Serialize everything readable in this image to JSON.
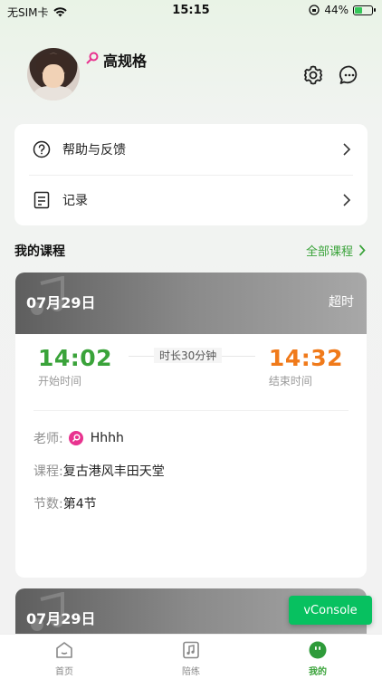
{
  "status_bar": {
    "carrier": "无SIM卡",
    "time": "15:15",
    "battery": "44%",
    "battery_level": 0.44
  },
  "profile": {
    "name": "高规格",
    "gender_icon": "female-symbol-icon"
  },
  "menu": [
    {
      "label": "帮助与反馈",
      "icon": "help-circle-icon"
    },
    {
      "label": "记录",
      "icon": "document-icon"
    }
  ],
  "courses_section": {
    "title": "我的课程",
    "link": "全部课程"
  },
  "courses": [
    {
      "date": "07月29日",
      "status": "超时",
      "start_time": "14:02",
      "start_label": "开始时间",
      "duration": "时长30分钟",
      "end_time": "14:32",
      "end_label": "结束时间",
      "teacher_key": "老师:",
      "teacher_value": "Hhhh",
      "course_key": "课程:",
      "course_value": "复古港风丰田天堂",
      "lesson_key": "节数:",
      "lesson_value": "第4节"
    },
    {
      "date": "07月29日"
    }
  ],
  "vconsole": "vConsole",
  "tabs": [
    {
      "label": "首页",
      "icon": "home-icon",
      "active": false
    },
    {
      "label": "陪练",
      "icon": "music-note-icon",
      "active": false
    },
    {
      "label": "我的",
      "icon": "smiley-face-icon",
      "active": true
    }
  ],
  "colors": {
    "accent": "#3aa33a",
    "end_time": "#f07a1a",
    "vconsole": "#07c160",
    "gender": "#e8338f"
  }
}
